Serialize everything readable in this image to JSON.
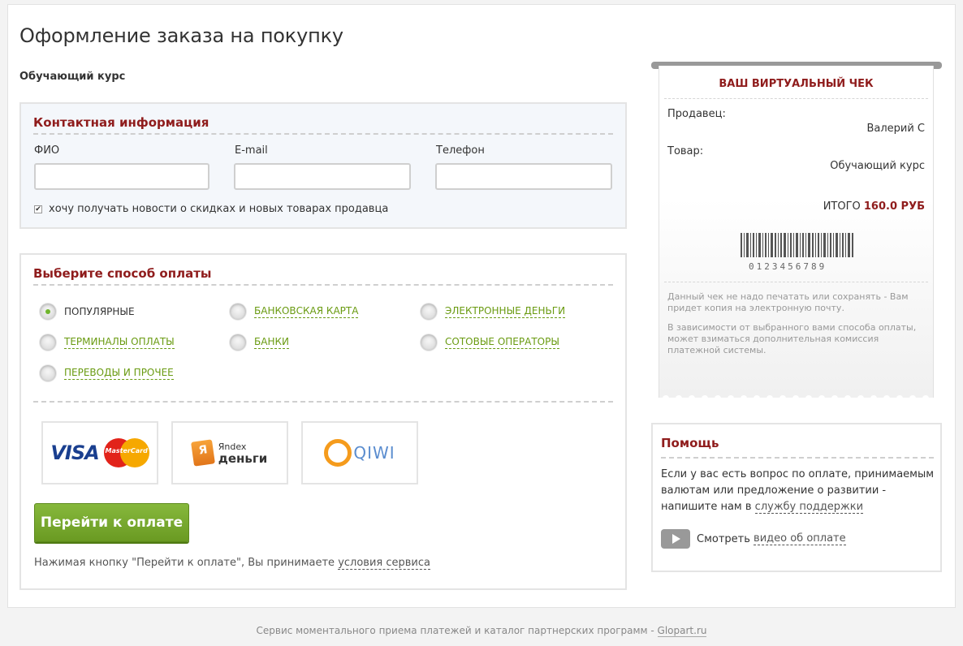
{
  "page": {
    "title": "Оформление заказа на покупку",
    "product": "Обучающий курс"
  },
  "contact": {
    "title": "Контактная информация",
    "fio_label": "ФИО",
    "email_label": "E-mail",
    "phone_label": "Телефон",
    "fio_value": "",
    "email_value": "",
    "phone_value": "",
    "newsletter_checked": true,
    "newsletter_label": "хочу получать новости о скидках и новых товарах продавца"
  },
  "payment": {
    "title": "Выберите способ оплаты",
    "methods": [
      {
        "label": "ПОПУЛЯРНЫЕ",
        "selected": true
      },
      {
        "label": "БАНКОВСКАЯ КАРТА",
        "selected": false
      },
      {
        "label": "ЭЛЕКТРОННЫЕ ДЕНЬГИ",
        "selected": false
      },
      {
        "label": "ТЕРМИНАЛЫ ОПЛАТЫ",
        "selected": false
      },
      {
        "label": "БАНКИ",
        "selected": false
      },
      {
        "label": "СОТОВЫЕ ОПЕРАТОРЫ",
        "selected": false
      },
      {
        "label": "ПЕРЕВОДЫ И ПРОЧЕЕ",
        "selected": false
      }
    ],
    "logos": {
      "visa": "VISA",
      "mastercard": "MasterCard",
      "yandex_top": "Яndex",
      "yandex_bottom": "деньги",
      "qiwi": "QIWI"
    },
    "button_label": "Перейти к оплате",
    "terms_prefix": "Нажимая кнопку \"Перейти к оплате\", Вы принимаете ",
    "terms_link": "условия сервиса"
  },
  "receipt": {
    "title": "ВАШ ВИРТУАЛЬНЫЙ ЧЕК",
    "seller_label": "Продавец:",
    "seller_value": "Валерий С",
    "product_label": "Товар:",
    "product_value": "Обучающий курс",
    "total_label": "ИТОГО ",
    "total_amount": "160.0 РУБ",
    "barcode_digits": "0123456789",
    "note1": "Данный чек не надо печатать или сохранять - Вам придет копия на электронную почту.",
    "note2": "В зависимости от выбранного вами способа оплаты, может взиматься дополнительная комиссия платежной системы."
  },
  "help": {
    "title": "Помощь",
    "text": "Если у вас есть вопрос по оплате, принимаемым валютам или предложение о развитии - напишите нам в ",
    "support_link": "службу поддержки",
    "video_prefix": "Смотреть ",
    "video_link": "видео об оплате"
  },
  "footer": {
    "text": "Сервис моментального приема платежей и каталог партнерских программ - ",
    "link": "Glopart.ru"
  },
  "colors": {
    "accent_red": "#8f1c1c",
    "accent_green": "#6a9b12",
    "button_green": "#7aab30"
  }
}
